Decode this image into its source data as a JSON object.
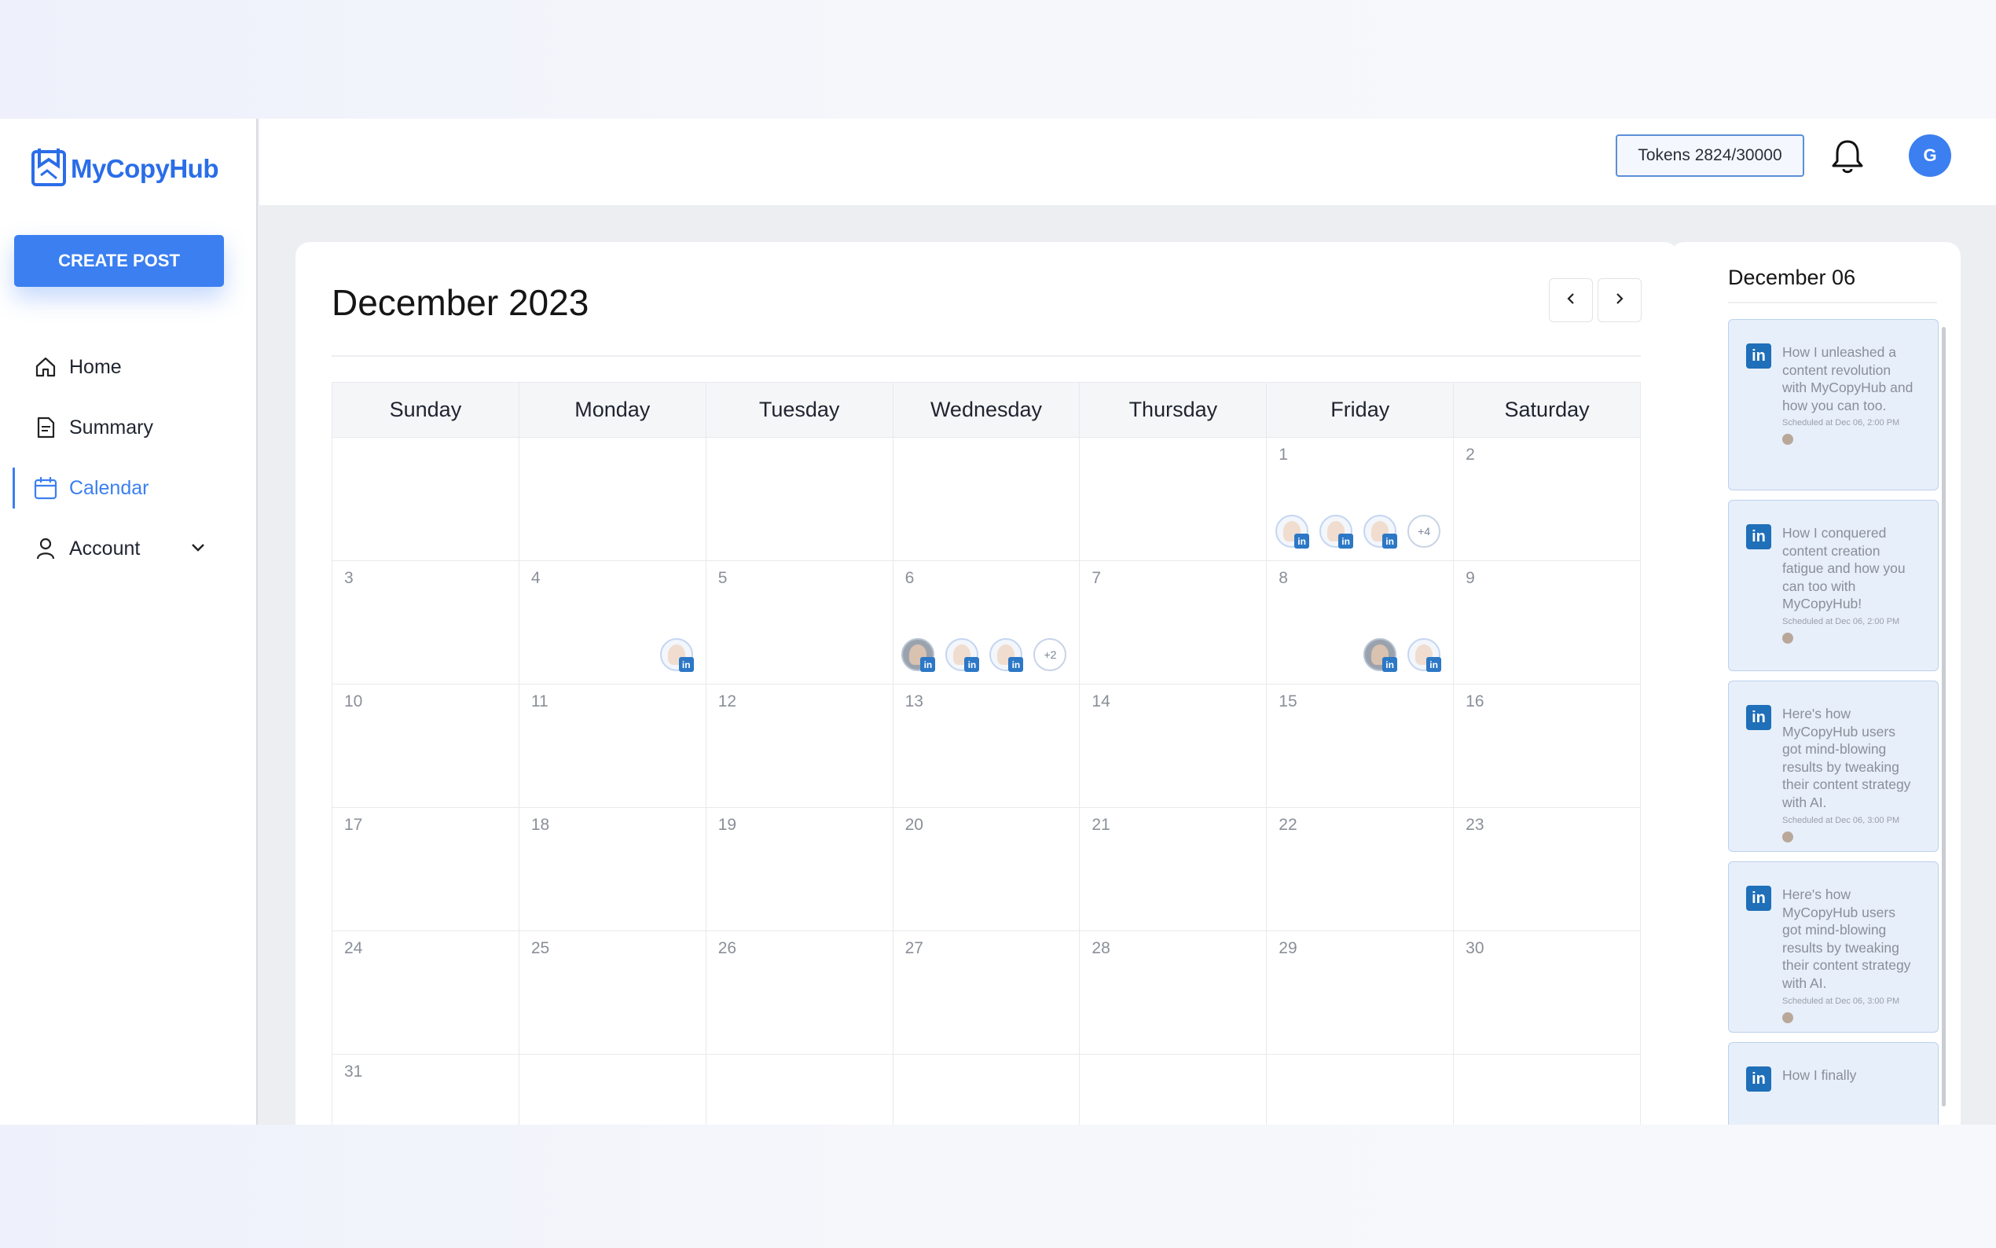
{
  "brand": {
    "name": "MyCopyHub",
    "accent": "#3b7ff1"
  },
  "sidebar": {
    "create_label": "CREATE POST",
    "items": [
      {
        "label": "Home",
        "icon": "home-icon"
      },
      {
        "label": "Summary",
        "icon": "document-icon"
      },
      {
        "label": "Calendar",
        "icon": "calendar-icon",
        "active": true
      },
      {
        "label": "Account",
        "icon": "user-icon",
        "expandable": true
      }
    ]
  },
  "topbar": {
    "tokens": "Tokens 2824/30000",
    "avatar_initial": "G"
  },
  "calendar": {
    "title": "December 2023",
    "weekdays": [
      "Sunday",
      "Monday",
      "Tuesday",
      "Wednesday",
      "Thursday",
      "Friday",
      "Saturday"
    ],
    "weeks": [
      [
        "",
        "",
        "",
        "",
        "",
        "1",
        "2"
      ],
      [
        "3",
        "4",
        "5",
        "6",
        "7",
        "8",
        "9"
      ],
      [
        "10",
        "11",
        "12",
        "13",
        "14",
        "15",
        "16"
      ],
      [
        "17",
        "18",
        "19",
        "20",
        "21",
        "22",
        "23"
      ],
      [
        "24",
        "25",
        "26",
        "27",
        "28",
        "29",
        "30"
      ],
      [
        "31",
        "",
        "",
        "",
        "",
        "",
        ""
      ]
    ],
    "events": {
      "1": {
        "avatars": [
          "default",
          "default",
          "default"
        ],
        "more": "+4"
      },
      "4": {
        "avatars": [
          "default"
        ],
        "more": ""
      },
      "6": {
        "avatars": [
          "photo",
          "default",
          "default"
        ],
        "more": "+2"
      },
      "8": {
        "avatars": [
          "photo",
          "default"
        ],
        "more": ""
      }
    }
  },
  "side_panel": {
    "title": "December 06",
    "posts": [
      {
        "text": "How I unleashed a content revolution with MyCopyHub and how you can too.",
        "schedule": "Scheduled at Dec 06, 2:00 PM"
      },
      {
        "text": "How I conquered content creation fatigue and how you can too with MyCopyHub!",
        "schedule": "Scheduled at Dec 06, 2:00 PM"
      },
      {
        "text": "Here's how MyCopyHub users got mind-blowing results by tweaking their content strategy with AI.",
        "schedule": "Scheduled at Dec 06, 3:00 PM"
      },
      {
        "text": "Here's how MyCopyHub users got mind-blowing results by tweaking their content strategy with AI.",
        "schedule": "Scheduled at Dec 06, 3:00 PM"
      },
      {
        "text": "How I finally",
        "schedule": ""
      }
    ]
  }
}
